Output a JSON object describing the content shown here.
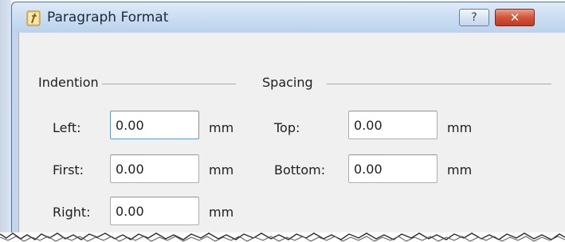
{
  "window": {
    "title": "Paragraph Format",
    "help_label": "?",
    "close_label": "✕"
  },
  "indention": {
    "label": "Indention",
    "fields": [
      {
        "label": "Left:",
        "value": "0.00",
        "unit": "mm",
        "focused": true
      },
      {
        "label": "First:",
        "value": "0.00",
        "unit": "mm"
      },
      {
        "label": "Right:",
        "value": "0.00",
        "unit": "mm"
      }
    ]
  },
  "spacing": {
    "label": "Spacing",
    "fields": [
      {
        "label": "Top:",
        "value": "0.00",
        "unit": "mm"
      },
      {
        "label": "Bottom:",
        "value": "0.00",
        "unit": "mm"
      }
    ]
  },
  "colors": {
    "close_button": "#c0391f",
    "title_bar": "#c9dcf1",
    "client_bg": "#f0f0f0"
  }
}
